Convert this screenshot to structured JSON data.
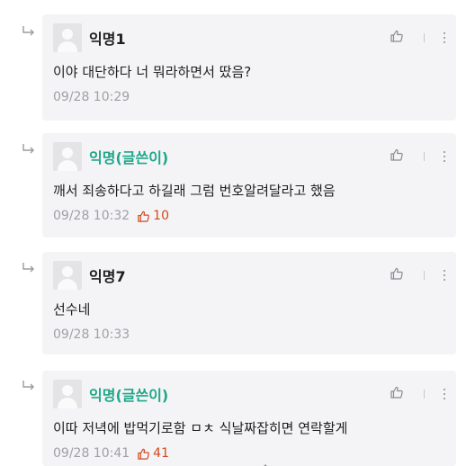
{
  "comments": [
    {
      "nick": "익명1",
      "is_writer": false,
      "text": "이야 대단하다 너 뭐라하면서 땄음?",
      "time": "09/28 10:29",
      "likes": ""
    },
    {
      "nick": "익명(글쓴이)",
      "is_writer": true,
      "text": "깨서 죄송하다고 하길래 그럼 번호알려달라고 했음",
      "time": "09/28 10:32",
      "likes": "10"
    },
    {
      "nick": "익명7",
      "is_writer": false,
      "text": "선수네",
      "time": "09/28 10:33",
      "likes": ""
    },
    {
      "nick": "익명(글쓴이)",
      "is_writer": true,
      "text": "이따 저녁에 밥먹기로함 ㅁㅊ 식날짜잡히면 연락할게",
      "time": "09/28 10:41",
      "likes": "41"
    }
  ],
  "icons": {
    "reply": "reply-arrow-icon",
    "like": "thumbs-up-icon",
    "more": "more-vertical-icon",
    "avatar": "default-avatar-icon"
  },
  "colors": {
    "writer_nick": "#1fa78a",
    "like_count": "#d4481e",
    "card_bg": "#f4f4f6",
    "meta": "#a0a0a6"
  }
}
